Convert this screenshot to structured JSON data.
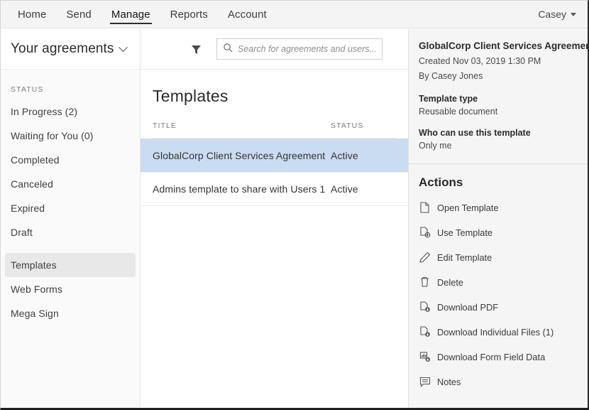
{
  "topnav": {
    "items": [
      {
        "label": "Home",
        "active": false
      },
      {
        "label": "Send",
        "active": false
      },
      {
        "label": "Manage",
        "active": true
      },
      {
        "label": "Reports",
        "active": false
      },
      {
        "label": "Account",
        "active": false
      }
    ],
    "user": "Casey"
  },
  "sidebar": {
    "title": "Your agreements",
    "status_label": "STATUS",
    "items": [
      {
        "label": "In Progress (2)",
        "selected": false
      },
      {
        "label": "Waiting for You (0)",
        "selected": false
      },
      {
        "label": "Completed",
        "selected": false
      },
      {
        "label": "Canceled",
        "selected": false
      },
      {
        "label": "Expired",
        "selected": false
      },
      {
        "label": "Draft",
        "selected": false
      }
    ],
    "items2": [
      {
        "label": "Templates",
        "selected": true
      },
      {
        "label": "Web Forms",
        "selected": false
      },
      {
        "label": "Mega Sign",
        "selected": false
      }
    ]
  },
  "toolbar": {
    "filter_icon": "filter-funnel-icon",
    "search_icon": "search-icon",
    "search_placeholder": "Search for agreements and users..."
  },
  "main": {
    "heading": "Templates",
    "columns": [
      "TITLE",
      "STATUS"
    ],
    "rows": [
      {
        "title": "GlobalCorp Client Services Agreement",
        "status": "Active",
        "selected": true
      },
      {
        "title": "Admins template to share with Users 1",
        "status": "Active",
        "selected": false
      }
    ]
  },
  "detail": {
    "title": "GlobalCorp Client Services Agreement",
    "created": "Created Nov 03, 2019 1:30 PM",
    "author": "By Casey Jones",
    "template_type_label": "Template type",
    "template_type_value": "Reusable document",
    "who_label": "Who can use this template",
    "who_value": "Only me",
    "actions_title": "Actions",
    "actions": [
      {
        "label": "Open Template",
        "icon": "document-icon"
      },
      {
        "label": "Use Template",
        "icon": "document-plus-icon"
      },
      {
        "label": "Edit Template",
        "icon": "pencil-icon"
      },
      {
        "label": "Delete",
        "icon": "trash-icon"
      },
      {
        "label": "Download PDF",
        "icon": "document-download-icon"
      },
      {
        "label": "Download Individual Files (1)",
        "icon": "document-download-icon"
      },
      {
        "label": "Download Form Field Data",
        "icon": "form-data-download-icon"
      },
      {
        "label": "Notes",
        "icon": "speech-bubble-icon"
      }
    ]
  },
  "colors": {
    "selected_row": "#c9dcf1",
    "nav_bar": "#f4f4f4",
    "detail_panel": "#f5f5f5",
    "sidebar_selected": "#e8e8e8"
  }
}
